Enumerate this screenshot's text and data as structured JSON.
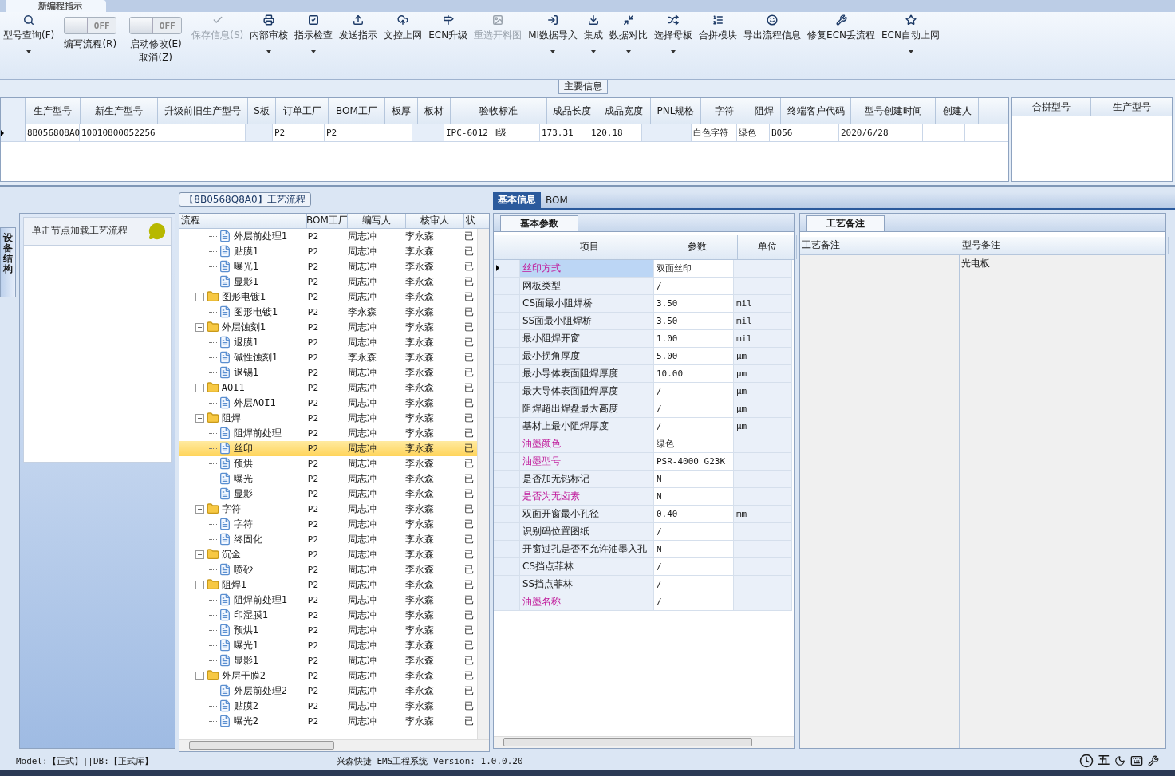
{
  "document_tab": {
    "title": "新编程指示"
  },
  "toolbar": [
    {
      "kind": "button",
      "label": "型号查询(F)",
      "disabled": false,
      "dropdown": true
    },
    {
      "kind": "toggle",
      "label": "编写流程(R)",
      "switch_text": "OFF",
      "on": false
    },
    {
      "kind": "toggle",
      "label": "启动修改(E)",
      "label2": "取消(Z)",
      "switch_text": "OFF",
      "on": false
    },
    {
      "kind": "button",
      "label": "保存信息(S)",
      "disabled": true,
      "dropdown": false
    },
    {
      "kind": "button",
      "label": "内部审核",
      "disabled": false,
      "dropdown": true
    },
    {
      "kind": "button",
      "label": "指示检查",
      "disabled": false,
      "dropdown": true
    },
    {
      "kind": "button",
      "label": "发送指示",
      "disabled": false,
      "dropdown": false
    },
    {
      "kind": "button",
      "label": "文控上网",
      "disabled": false,
      "dropdown": false
    },
    {
      "kind": "button",
      "label": "ECN升级",
      "disabled": false,
      "dropdown": false
    },
    {
      "kind": "button",
      "label": "重选开料图",
      "disabled": true,
      "dropdown": false
    },
    {
      "kind": "button",
      "label": "MI数据导入",
      "disabled": false,
      "dropdown": true
    },
    {
      "kind": "button",
      "label": "集成",
      "disabled": false,
      "dropdown": true
    },
    {
      "kind": "button",
      "label": "数据对比",
      "disabled": false,
      "dropdown": true
    },
    {
      "kind": "button",
      "label": "选择母板",
      "disabled": false,
      "dropdown": true
    },
    {
      "kind": "button",
      "label": "合拼模块",
      "disabled": false,
      "dropdown": false
    },
    {
      "kind": "button",
      "label": "导出流程信息",
      "disabled": false,
      "dropdown": false
    },
    {
      "kind": "button",
      "label": "修复ECN丢流程",
      "disabled": false,
      "dropdown": false
    },
    {
      "kind": "button",
      "label": "ECN自动上网",
      "disabled": false,
      "dropdown": true
    }
  ],
  "main_info": {
    "title": "主要信息",
    "columns": [
      "生产型号",
      "新生产型号",
      "升级前旧生产型号",
      "S板",
      "订单工厂",
      "BOM工厂",
      "板厚",
      "板材",
      "验收标准",
      "成品长度",
      "成品宽度",
      "PNL规格",
      "字符",
      "阻焊",
      "终端客户代码",
      "型号创建时间",
      "创建人"
    ],
    "rows": [
      {
        "selected": true,
        "cells": [
          "8B0568Q8A0",
          "10010800052256",
          "",
          "",
          "P2",
          "P2",
          "",
          "",
          "IPC-6012 Ⅱ级",
          "173.31",
          "120.18",
          "",
          "白色字符",
          "绿色",
          "B056",
          "2020/6/28",
          ""
        ]
      }
    ],
    "merge_table": {
      "columns": [
        "合拼型号",
        "生产型号"
      ]
    }
  },
  "side_tab": {
    "label": "设备结构"
  },
  "side_panel": {
    "hint": "单击节点加载工艺流程"
  },
  "process": {
    "title": "【8B0568Q8A0】工艺流程",
    "columns": [
      "流程",
      "BOM工厂",
      "编写人",
      "核审人",
      "状"
    ],
    "tree": [
      {
        "children": [
          {
            "name": "外层前处理1",
            "factory": "P2",
            "writer": "周志冲",
            "reviewer": "李永森",
            "status": "已",
            "selected": false
          },
          {
            "name": "贴膜1",
            "factory": "P2",
            "writer": "周志冲",
            "reviewer": "李永森",
            "status": "已",
            "selected": false
          },
          {
            "name": "曝光1",
            "factory": "P2",
            "writer": "周志冲",
            "reviewer": "李永森",
            "status": "已",
            "selected": false
          },
          {
            "name": "显影1",
            "factory": "P2",
            "writer": "周志冲",
            "reviewer": "李永森",
            "status": "已",
            "selected": false
          }
        ]
      },
      {
        "name": "图形电镀1",
        "factory": "P2",
        "writer": "周志冲",
        "reviewer": "李永森",
        "status": "已",
        "selected": false,
        "expanded": true,
        "children": [
          {
            "name": "图形电镀1",
            "factory": "P2",
            "writer": "李永森",
            "reviewer": "李永森",
            "status": "已",
            "selected": false
          }
        ]
      },
      {
        "name": "外层蚀刻1",
        "factory": "P2",
        "writer": "周志冲",
        "reviewer": "李永森",
        "status": "已",
        "selected": false,
        "expanded": true,
        "children": [
          {
            "name": "退膜1",
            "factory": "P2",
            "writer": "周志冲",
            "reviewer": "李永森",
            "status": "已",
            "selected": false
          },
          {
            "name": "碱性蚀刻1",
            "factory": "P2",
            "writer": "李永森",
            "reviewer": "李永森",
            "status": "已",
            "selected": false
          },
          {
            "name": "退锡1",
            "factory": "P2",
            "writer": "周志冲",
            "reviewer": "李永森",
            "status": "已",
            "selected": false
          }
        ]
      },
      {
        "name": "AOI1",
        "factory": "P2",
        "writer": "周志冲",
        "reviewer": "李永森",
        "status": "已",
        "selected": false,
        "expanded": true,
        "children": [
          {
            "name": "外层AOI1",
            "factory": "P2",
            "writer": "周志冲",
            "reviewer": "李永森",
            "status": "已",
            "selected": false
          }
        ]
      },
      {
        "name": "阻焊",
        "factory": "P2",
        "writer": "周志冲",
        "reviewer": "李永森",
        "status": "已",
        "selected": false,
        "expanded": true,
        "children": [
          {
            "name": "阻焊前处理",
            "factory": "P2",
            "writer": "周志冲",
            "reviewer": "李永森",
            "status": "已",
            "selected": false
          },
          {
            "name": "丝印",
            "factory": "P2",
            "writer": "周志冲",
            "reviewer": "李永森",
            "status": "已",
            "selected": true
          },
          {
            "name": "预烘",
            "factory": "P2",
            "writer": "周志冲",
            "reviewer": "李永森",
            "status": "已",
            "selected": false
          },
          {
            "name": "曝光",
            "factory": "P2",
            "writer": "周志冲",
            "reviewer": "李永森",
            "status": "已",
            "selected": false
          },
          {
            "name": "显影",
            "factory": "P2",
            "writer": "周志冲",
            "reviewer": "李永森",
            "status": "已",
            "selected": false
          }
        ]
      },
      {
        "name": "字符",
        "factory": "P2",
        "writer": "周志冲",
        "reviewer": "李永森",
        "status": "已",
        "selected": false,
        "expanded": true,
        "children": [
          {
            "name": "字符",
            "factory": "P2",
            "writer": "周志冲",
            "reviewer": "李永森",
            "status": "已",
            "selected": false
          },
          {
            "name": "终固化",
            "factory": "P2",
            "writer": "周志冲",
            "reviewer": "李永森",
            "status": "已",
            "selected": false
          }
        ]
      },
      {
        "name": "沉金",
        "factory": "P2",
        "writer": "周志冲",
        "reviewer": "李永森",
        "status": "已",
        "selected": false,
        "expanded": true,
        "children": [
          {
            "name": "喷砂",
            "factory": "P2",
            "writer": "周志冲",
            "reviewer": "李永森",
            "status": "已",
            "selected": false
          }
        ]
      },
      {
        "name": "阻焊1",
        "factory": "P2",
        "writer": "周志冲",
        "reviewer": "李永森",
        "status": "已",
        "selected": false,
        "expanded": true,
        "children": [
          {
            "name": "阻焊前处理1",
            "factory": "P2",
            "writer": "周志冲",
            "reviewer": "李永森",
            "status": "已",
            "selected": false
          },
          {
            "name": "印湿膜1",
            "factory": "P2",
            "writer": "周志冲",
            "reviewer": "李永森",
            "status": "已",
            "selected": false
          },
          {
            "name": "预烘1",
            "factory": "P2",
            "writer": "周志冲",
            "reviewer": "李永森",
            "status": "已",
            "selected": false
          },
          {
            "name": "曝光1",
            "factory": "P2",
            "writer": "周志冲",
            "reviewer": "李永森",
            "status": "已",
            "selected": false
          },
          {
            "name": "显影1",
            "factory": "P2",
            "writer": "周志冲",
            "reviewer": "李永森",
            "status": "已",
            "selected": false
          }
        ]
      },
      {
        "name": "外层干膜2",
        "factory": "P2",
        "writer": "周志冲",
        "reviewer": "李永森",
        "status": "已",
        "selected": false,
        "expanded": true,
        "children": [
          {
            "name": "外层前处理2",
            "factory": "P2",
            "writer": "周志冲",
            "reviewer": "李永森",
            "status": "已",
            "selected": false
          },
          {
            "name": "贴膜2",
            "factory": "P2",
            "writer": "周志冲",
            "reviewer": "李永森",
            "status": "已",
            "selected": false
          },
          {
            "name": "曝光2",
            "factory": "P2",
            "writer": "周志冲",
            "reviewer": "李永森",
            "status": "已",
            "selected": false
          }
        ]
      }
    ]
  },
  "detail_tabs": [
    {
      "label": "基本信息",
      "selected": true
    },
    {
      "label": "BOM",
      "selected": false
    }
  ],
  "basic_params": {
    "tab": "基本参数",
    "columns": [
      "项目",
      "参数",
      "单位"
    ],
    "rows": [
      {
        "item": "丝印方式",
        "value": "双面丝印",
        "unit": "",
        "highlighted": true,
        "selected": true
      },
      {
        "item": "网板类型",
        "value": "/",
        "unit": "",
        "highlighted": false,
        "selected": false
      },
      {
        "item": "CS面最小阻焊桥",
        "value": "3.50",
        "unit": "mil",
        "highlighted": false,
        "selected": false
      },
      {
        "item": "SS面最小阻焊桥",
        "value": "3.50",
        "unit": "mil",
        "highlighted": false,
        "selected": false
      },
      {
        "item": "最小阻焊开窗",
        "value": "1.00",
        "unit": "mil",
        "highlighted": false,
        "selected": false
      },
      {
        "item": "最小拐角厚度",
        "value": "5.00",
        "unit": "μm",
        "highlighted": false,
        "selected": false
      },
      {
        "item": "最小导体表面阻焊厚度",
        "value": "10.00",
        "unit": "μm",
        "highlighted": false,
        "selected": false
      },
      {
        "item": "最大导体表面阻焊厚度",
        "value": "/",
        "unit": "μm",
        "highlighted": false,
        "selected": false
      },
      {
        "item": "阻焊超出焊盘最大高度",
        "value": "/",
        "unit": "μm",
        "highlighted": false,
        "selected": false
      },
      {
        "item": "基材上最小阻焊厚度",
        "value": "/",
        "unit": "μm",
        "highlighted": false,
        "selected": false
      },
      {
        "item": "油墨颜色",
        "value": "绿色",
        "unit": "",
        "highlighted": true,
        "selected": false
      },
      {
        "item": "油墨型号",
        "value": "PSR-4000 G23K",
        "unit": "",
        "highlighted": true,
        "selected": false
      },
      {
        "item": "是否加无铅标记",
        "value": "N",
        "unit": "",
        "highlighted": false,
        "selected": false
      },
      {
        "item": "是否为无卤素",
        "value": "N",
        "unit": "",
        "highlighted": true,
        "selected": false
      },
      {
        "item": "双面开窗最小孔径",
        "value": "0.40",
        "unit": "mm",
        "highlighted": false,
        "selected": false
      },
      {
        "item": "识别码位置图纸",
        "value": "/",
        "unit": "",
        "highlighted": false,
        "selected": false
      },
      {
        "item": "开窗过孔是否不允许油墨入孔",
        "value": "N",
        "unit": "",
        "highlighted": false,
        "selected": false
      },
      {
        "item": "CS挡点菲林",
        "value": "/",
        "unit": "",
        "highlighted": false,
        "selected": false
      },
      {
        "item": "SS挡点菲林",
        "value": "/",
        "unit": "",
        "highlighted": false,
        "selected": false
      },
      {
        "item": "油墨名称",
        "value": "/",
        "unit": "",
        "highlighted": true,
        "selected": false
      }
    ]
  },
  "remarks": {
    "tab": "工艺备注",
    "columns": [
      "工艺备注",
      "型号备注"
    ],
    "model_remark": "光电板"
  },
  "status_bar": {
    "left": "Model:【正式】||DB:【正式库】",
    "center": "兴森快捷 EMS工程系统 Version: 1.0.0.20"
  },
  "tray": {
    "ime": "五"
  }
}
